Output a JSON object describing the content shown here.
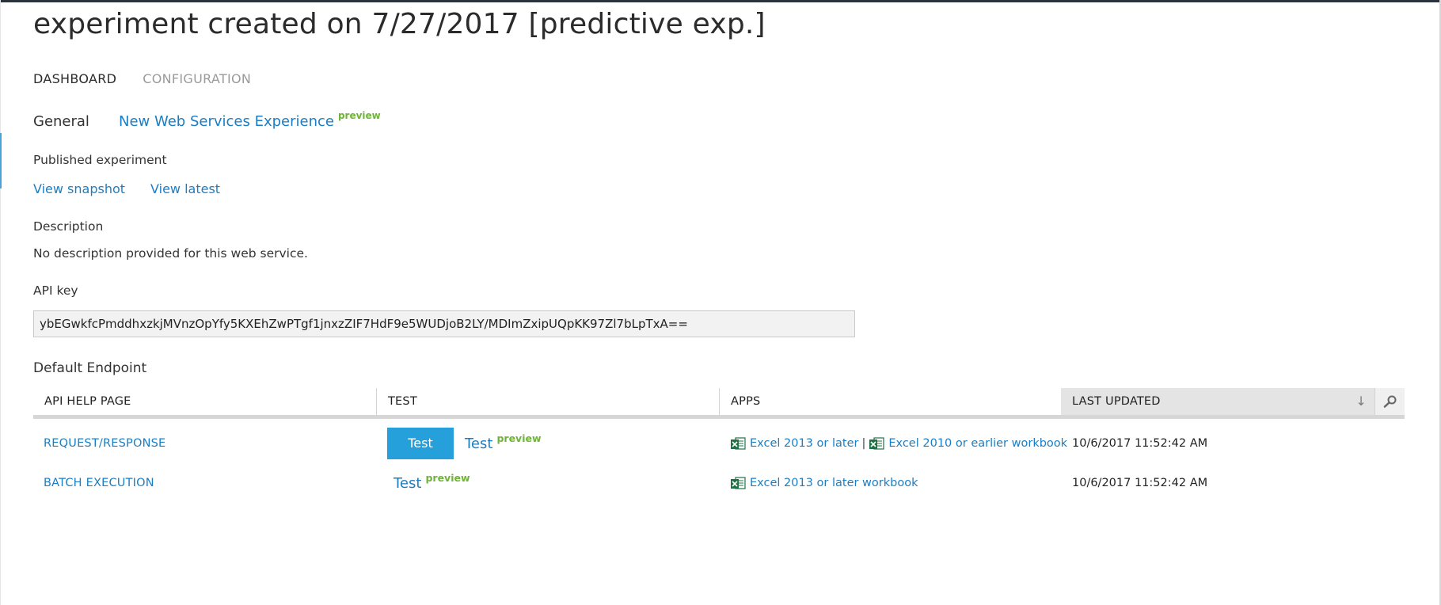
{
  "page": {
    "title": "experiment created on 7/27/2017 [predictive exp.]"
  },
  "tabs": [
    {
      "label": "DASHBOARD",
      "active": true
    },
    {
      "label": "CONFIGURATION",
      "active": false
    }
  ],
  "subtabs": {
    "general": "General",
    "new_ws": "New Web Services Experience",
    "preview": "preview"
  },
  "published": {
    "label": "Published experiment",
    "view_snapshot": "View snapshot",
    "view_latest": "View latest"
  },
  "description": {
    "label": "Description",
    "text": "No description provided for this web service."
  },
  "api_key": {
    "label": "API key",
    "value": "ybEGwkfcPmddhxzkjMVnzOpYfy5KXEhZwPTgf1jnxzZIF7HdF9e5WUDjoB2LY/MDImZxipUQpKK97Zl7bLpTxA=="
  },
  "endpoint": {
    "title": "Default Endpoint",
    "columns": [
      "API HELP PAGE",
      "TEST",
      "APPS",
      "LAST UPDATED"
    ],
    "sort_icon": "arrow-down-icon",
    "search_icon": "search-icon",
    "rows": [
      {
        "help_page": "REQUEST/RESPONSE",
        "test_button": "Test",
        "test_link": "Test",
        "preview": "preview",
        "apps": [
          "Excel 2013 or later",
          "Excel 2010 or earlier workbook"
        ],
        "separator": "|",
        "last_updated": "10/6/2017 11:52:42 AM"
      },
      {
        "help_page": "BATCH EXECUTION",
        "test_link": "Test",
        "preview": "preview",
        "apps": [
          "Excel 2013 or later workbook"
        ],
        "last_updated": "10/6/2017 11:52:42 AM"
      }
    ]
  },
  "colors": {
    "link": "#1b7ec4",
    "preview": "#6fb33b",
    "button": "#25a0da",
    "topbar": "#2b323b"
  }
}
